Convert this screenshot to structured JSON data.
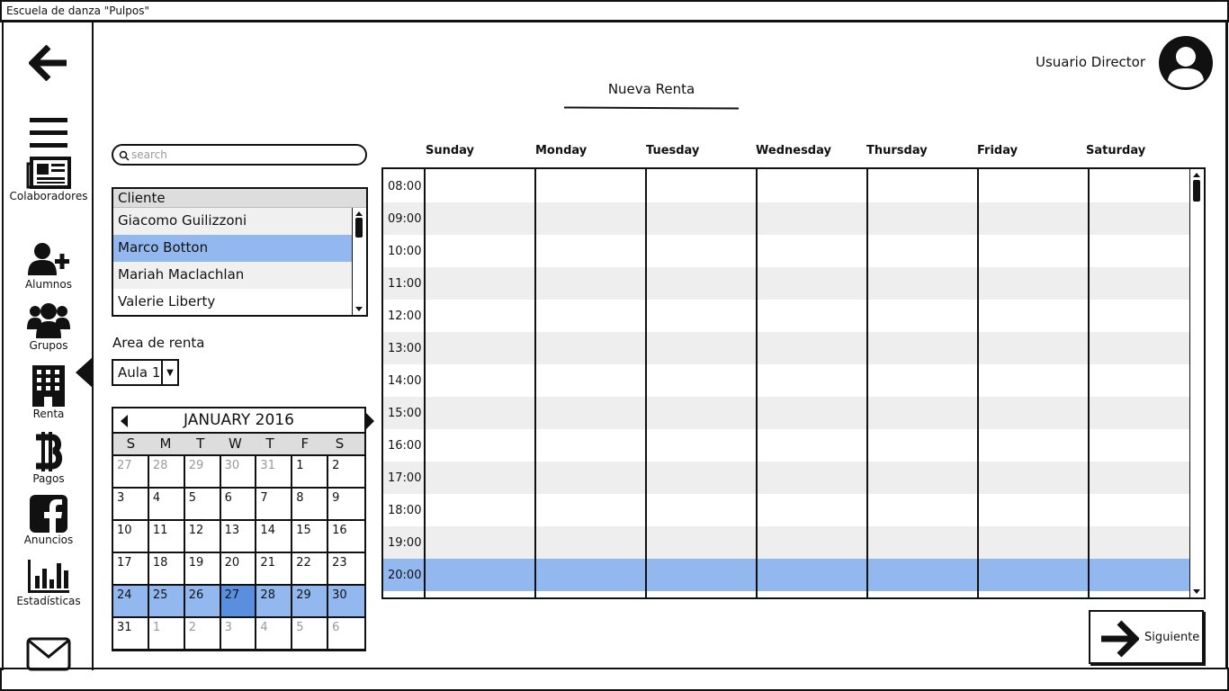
{
  "window": {
    "title": "Escuela de danza \"Pulpos\""
  },
  "header": {
    "user_name": "Usuario Director",
    "page_title": "Nueva Renta"
  },
  "sidebar": {
    "items": [
      {
        "label": "Colaboradores",
        "icon": "newspaper-icon"
      },
      {
        "label": "Alumnos",
        "icon": "user-plus-icon"
      },
      {
        "label": "Grupos",
        "icon": "users-icon"
      },
      {
        "label": "Renta",
        "icon": "building-icon"
      },
      {
        "label": "Pagos",
        "icon": "bitcoin-icon"
      },
      {
        "label": "Anuncios",
        "icon": "facebook-icon"
      },
      {
        "label": "Estadísticas",
        "icon": "bar-chart-icon"
      }
    ],
    "active": "Renta"
  },
  "search": {
    "placeholder": "search"
  },
  "clients": {
    "header": "Cliente",
    "rows": [
      "Giacomo Guilizzoni",
      "Marco Botton",
      "Mariah Maclachlan",
      "Valerie Liberty"
    ],
    "selected": "Marco Botton"
  },
  "area": {
    "label": "Area de renta",
    "value": "Aula 1"
  },
  "calendar": {
    "title": "JANUARY 2016",
    "dow": [
      "S",
      "M",
      "T",
      "W",
      "T",
      "F",
      "S"
    ],
    "weeks": [
      [
        "27",
        "28",
        "29",
        "30",
        "31",
        "1",
        "2"
      ],
      [
        "3",
        "4",
        "5",
        "6",
        "7",
        "8",
        "9"
      ],
      [
        "10",
        "11",
        "12",
        "13",
        "14",
        "15",
        "16"
      ],
      [
        "17",
        "18",
        "19",
        "20",
        "21",
        "22",
        "23"
      ],
      [
        "24",
        "25",
        "26",
        "27",
        "28",
        "29",
        "30"
      ],
      [
        "31",
        "1",
        "2",
        "3",
        "4",
        "5",
        "6"
      ]
    ],
    "selected_day": "27"
  },
  "schedule": {
    "days": [
      "Sunday",
      "Monday",
      "Tuesday",
      "Wednesday",
      "Thursday",
      "Friday",
      "Saturday"
    ],
    "times": [
      "08:00",
      "09:00",
      "10:00",
      "11:00",
      "12:00",
      "13:00",
      "14:00",
      "15:00",
      "16:00",
      "17:00",
      "18:00",
      "19:00",
      "20:00"
    ],
    "selected_time": "20:00"
  },
  "actions": {
    "next_label": "Siguiente"
  },
  "colors": {
    "highlight": "#93b8f0",
    "selected_day": "#5a8fe0"
  }
}
